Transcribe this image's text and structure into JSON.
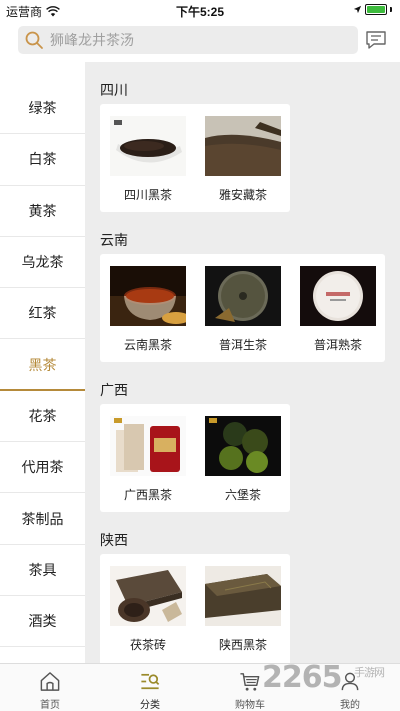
{
  "status": {
    "carrier": "运营商",
    "time": "下午5:25"
  },
  "search": {
    "placeholder": "狮峰龙井茶汤"
  },
  "sidebar": {
    "items": [
      {
        "label": "绿茶"
      },
      {
        "label": "白茶"
      },
      {
        "label": "黄茶"
      },
      {
        "label": "乌龙茶"
      },
      {
        "label": "红茶"
      },
      {
        "label": "黑茶",
        "active": true
      },
      {
        "label": "花茶"
      },
      {
        "label": "代用茶"
      },
      {
        "label": "茶制品"
      },
      {
        "label": "茶具"
      },
      {
        "label": "酒类"
      }
    ]
  },
  "sections": [
    {
      "title": "四川",
      "products": [
        {
          "name": "四川黑茶",
          "icon": "dark-tea-bowl-image"
        },
        {
          "name": "雅安藏茶",
          "icon": "loose-tea-image"
        }
      ]
    },
    {
      "title": "云南",
      "products": [
        {
          "name": "云南黑茶",
          "icon": "tea-cup-image"
        },
        {
          "name": "普洱生茶",
          "icon": "puer-cake-image"
        },
        {
          "name": "普洱熟茶",
          "icon": "puer-cake-wrapped-image"
        }
      ]
    },
    {
      "title": "广西",
      "products": [
        {
          "name": "广西黑茶",
          "icon": "tea-box-image"
        },
        {
          "name": "六堡茶",
          "icon": "liubao-tea-image"
        }
      ]
    },
    {
      "title": "陕西",
      "products": [
        {
          "name": "茯茶砖",
          "icon": "tea-brick-image"
        },
        {
          "name": "陕西黑茶",
          "icon": "tea-block-image"
        }
      ]
    }
  ],
  "tabbar": {
    "items": [
      {
        "label": "首页",
        "icon": "home-icon"
      },
      {
        "label": "分类",
        "icon": "category-icon",
        "active": true
      },
      {
        "label": "购物车",
        "icon": "cart-icon"
      },
      {
        "label": "我的",
        "icon": "profile-icon"
      }
    ]
  },
  "watermark": {
    "text": "2265",
    "sub": "手游网"
  },
  "colors": {
    "accent": "#b58a3a",
    "background": "#ededed"
  }
}
